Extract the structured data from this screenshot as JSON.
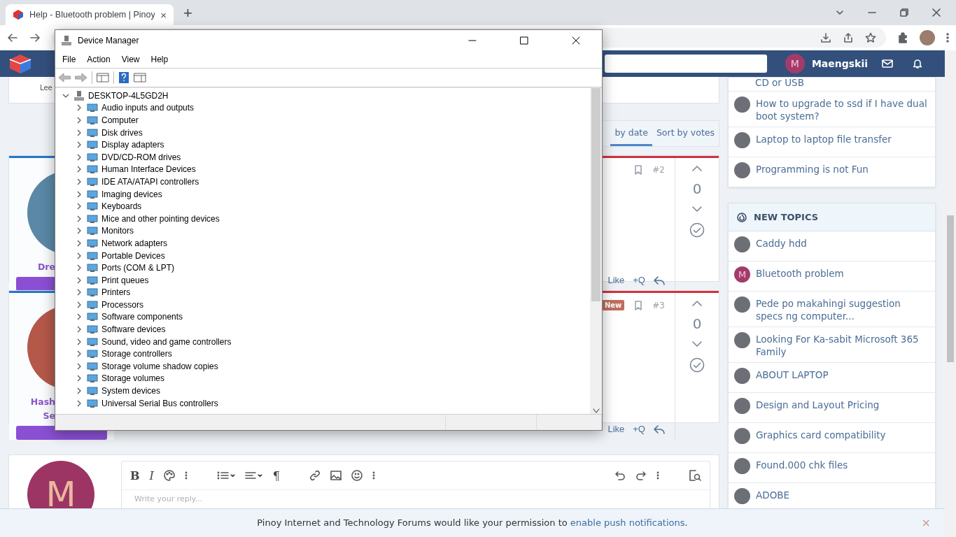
{
  "browser": {
    "tab_title": "Help - Bluetooth problem | Pinoy",
    "tab_close": "×",
    "new_tab": "+"
  },
  "site": {
    "user": {
      "avatar": "M",
      "name": "Maengskii"
    },
    "top_card": {
      "text": "Lee"
    },
    "sort_tabs": [
      {
        "label": "by date",
        "selected": true
      },
      {
        "label": "Sort by votes",
        "selected": false
      }
    ],
    "posts": [
      {
        "author": [
          "Dre"
        ],
        "number": "#2",
        "votes": "0",
        "like": "Like",
        "quote": "+Q"
      },
      {
        "badge": "New",
        "author": [
          "Hash",
          "Se"
        ],
        "number": "#3",
        "votes": "0",
        "like": "Like",
        "quote": "+Q"
      }
    ],
    "editor": {
      "avatar": "M",
      "bold": "B",
      "italic": "I",
      "paragraph": "¶",
      "placeholder": "Write your reply..."
    },
    "similar": {
      "cut_title": "CD or USB",
      "items": [
        {
          "title": "How to upgrade to ssd if I have dual boot system?"
        },
        {
          "title": "Laptop to laptop file transfer"
        },
        {
          "title": "Programming is not Fun"
        }
      ]
    },
    "new_topics": {
      "heading": "NEW TOPICS",
      "items": [
        {
          "title": "Caddy hdd"
        },
        {
          "title": "Bluetooth problem",
          "avatar": "M"
        },
        {
          "title": "Pede po makahingi suggestion specs ng computer..."
        },
        {
          "title": "Looking For Ka-sabit Microsoft 365 Family"
        },
        {
          "title": "ABOUT LAPTOP"
        },
        {
          "title": "Design and Layout Pricing"
        },
        {
          "title": "Graphics card compatibility"
        },
        {
          "title": "Found.000 chk files"
        },
        {
          "title": "ADOBE"
        }
      ]
    },
    "notification": {
      "text": "Pinoy Internet and Technology Forums would like your permission to ",
      "link": "enable push notifications",
      "end": ".",
      "close": "×"
    }
  },
  "device_manager": {
    "title": "Device Manager",
    "menu": [
      "File",
      "Action",
      "View",
      "Help"
    ],
    "tree": {
      "label": "DESKTOP-4L5GD2H",
      "expanded": true,
      "children": [
        {
          "label": "Audio inputs and outputs",
          "expanded": false
        },
        {
          "label": "Computer",
          "expanded": false
        },
        {
          "label": "Disk drives",
          "expanded": false
        },
        {
          "label": "Display adapters",
          "expanded": false
        },
        {
          "label": "DVD/CD-ROM drives",
          "expanded": false
        },
        {
          "label": "Human Interface Devices",
          "expanded": false
        },
        {
          "label": "IDE ATA/ATAPI controllers",
          "expanded": false
        },
        {
          "label": "Imaging devices",
          "expanded": false
        },
        {
          "label": "Keyboards",
          "expanded": false
        },
        {
          "label": "Mice and other pointing devices",
          "expanded": false
        },
        {
          "label": "Monitors",
          "expanded": false
        },
        {
          "label": "Network adapters",
          "expanded": false
        },
        {
          "label": "Portable Devices",
          "expanded": false
        },
        {
          "label": "Ports (COM & LPT)",
          "expanded": false
        },
        {
          "label": "Print queues",
          "expanded": false
        },
        {
          "label": "Printers",
          "expanded": false
        },
        {
          "label": "Processors",
          "expanded": false
        },
        {
          "label": "Software components",
          "expanded": false
        },
        {
          "label": "Software devices",
          "expanded": false
        },
        {
          "label": "Sound, video and game controllers",
          "expanded": false
        },
        {
          "label": "Storage controllers",
          "expanded": false
        },
        {
          "label": "Storage volume shadow copies",
          "expanded": false
        },
        {
          "label": "Storage volumes",
          "expanded": false
        },
        {
          "label": "System devices",
          "expanded": false
        },
        {
          "label": "Universal Serial Bus controllers",
          "expanded": false
        }
      ]
    }
  }
}
